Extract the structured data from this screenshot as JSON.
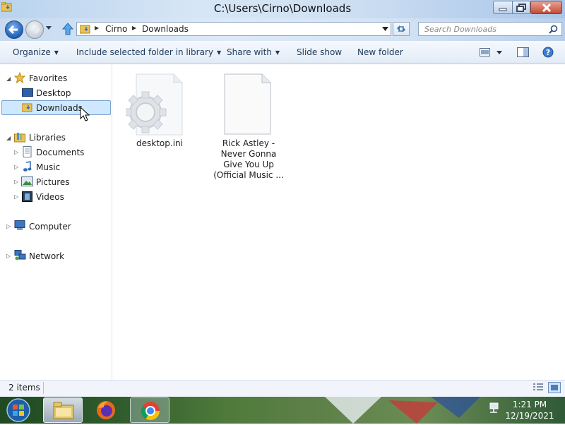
{
  "window": {
    "title": "C:\\Users\\Cirno\\Downloads"
  },
  "address": {
    "crumbs": [
      "Cirno",
      "Downloads"
    ]
  },
  "search": {
    "placeholder": "Search Downloads"
  },
  "toolbar": {
    "organize": "Organize",
    "include_library": "Include selected folder in library",
    "share_with": "Share with",
    "slide_show": "Slide show",
    "new_folder": "New folder"
  },
  "nav": {
    "favorites": "Favorites",
    "desktop": "Desktop",
    "downloads": "Downloads",
    "libraries": "Libraries",
    "documents": "Documents",
    "music": "Music",
    "pictures": "Pictures",
    "videos": "Videos",
    "computer": "Computer",
    "network": "Network",
    "selected": "Downloads"
  },
  "files": [
    {
      "name": "desktop.ini",
      "icon": "settings-file-icon"
    },
    {
      "name": "Rick Astley - Never Gonna Give You Up (Official Music ...",
      "line1": "Rick Astley -",
      "line2": "Never Gonna",
      "line3": "Give You Up",
      "line4": "(Official Music ...",
      "icon": "blank-file-icon"
    }
  ],
  "status": {
    "item_count": "2 items"
  },
  "taskbar": {
    "time": "1:21 PM",
    "date": "12/19/2021",
    "pinned": [
      "start-orb-icon",
      "explorer-icon",
      "firefox-icon",
      "chrome-icon"
    ]
  },
  "colors": {
    "selection_bg": "#cde8ff",
    "selection_border": "#7da2ce",
    "toolbar_text": "#1e395b",
    "close_button": "#c74a36"
  }
}
